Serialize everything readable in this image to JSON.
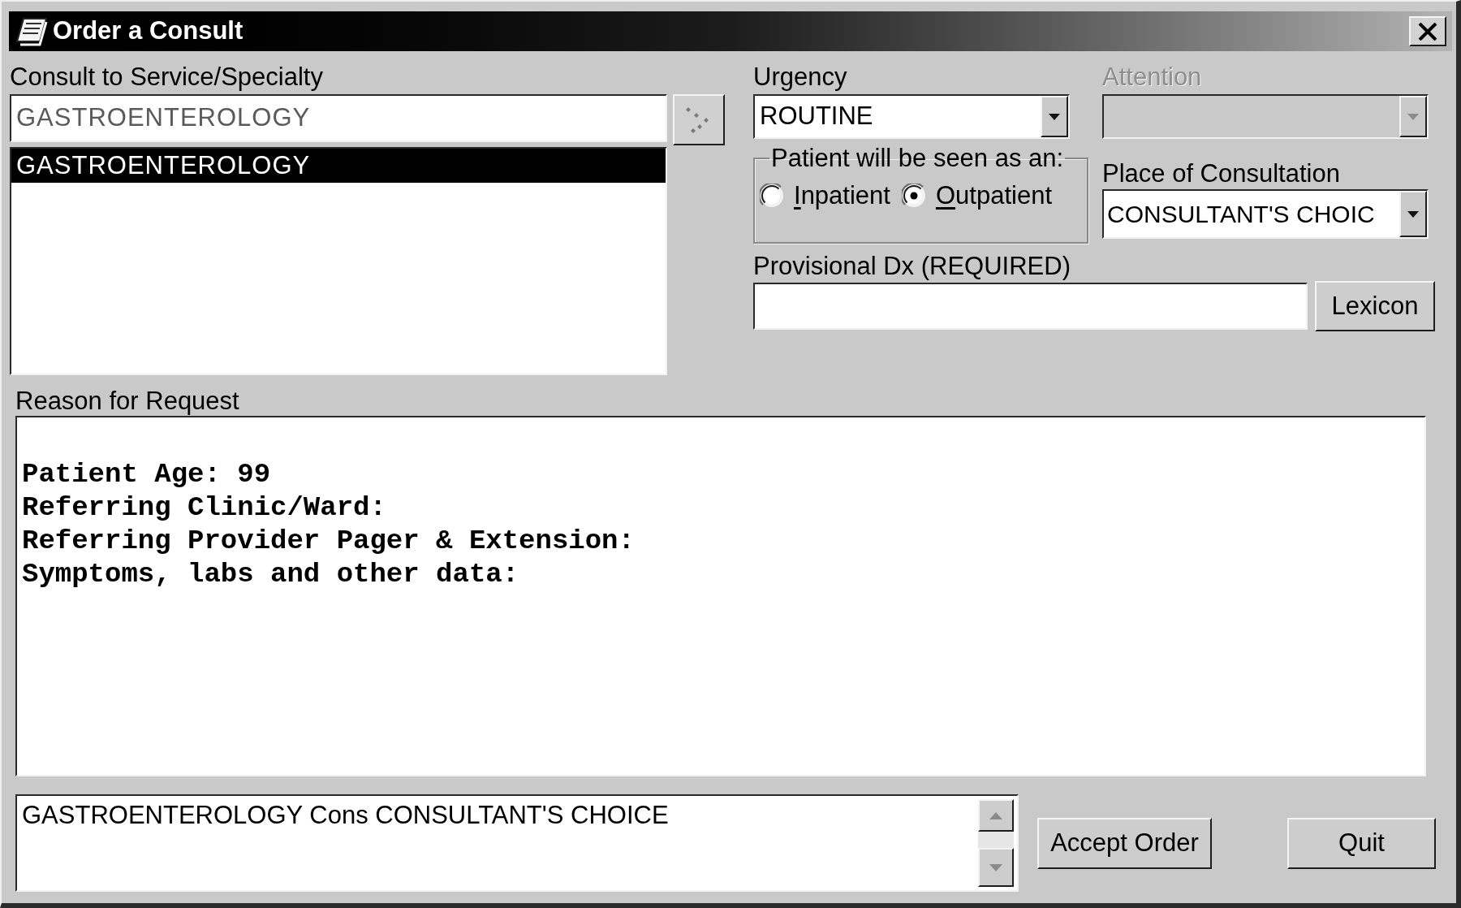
{
  "window": {
    "title": "Order a Consult"
  },
  "service": {
    "label": "Consult to Service/Specialty",
    "value": "GASTROENTEROLOGY",
    "items": [
      {
        "text": "GASTROENTEROLOGY",
        "selected": true
      }
    ]
  },
  "urgency": {
    "label": "Urgency",
    "value": "ROUTINE"
  },
  "attention": {
    "label": "Attention",
    "disabled": true
  },
  "seen_as": {
    "legend": "Patient will be seen as an:",
    "options": [
      {
        "label": "Inpatient",
        "selected": false,
        "access_key_underlined": true
      },
      {
        "label": "Outpatient",
        "selected": true,
        "access_key_underlined": true
      }
    ]
  },
  "place": {
    "label": "Place of Consultation",
    "value": "CONSULTANT'S CHOIC"
  },
  "provisional_dx": {
    "label": "Provisional Dx (REQUIRED)",
    "button": "Lexicon"
  },
  "reason": {
    "label": "Reason for Request",
    "lines": [
      "Patient Age: 99",
      "Referring Clinic/Ward:",
      "Referring Provider Pager & Extension:",
      "Symptoms, labs and other data:"
    ]
  },
  "order_summary": {
    "text": "GASTROENTEROLOGY Cons CONSULTANT'S CHOICE"
  },
  "buttons": [
    {
      "label": "Accept Order"
    },
    {
      "label": "Quit"
    }
  ]
}
